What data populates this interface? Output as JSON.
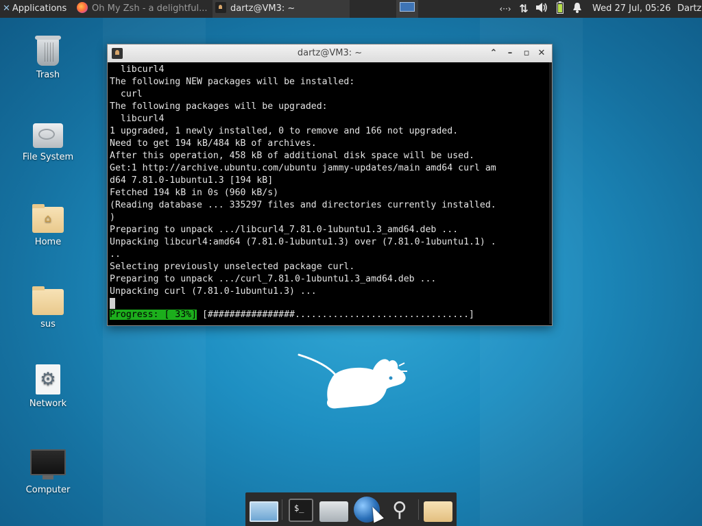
{
  "top_panel": {
    "apps_menu_label": "Applications",
    "tasks": [
      {
        "label": "Oh My Zsh - a delightful...",
        "icon": "firefox-icon",
        "active": false
      },
      {
        "label": "dartz@VM3: ~",
        "icon": "terminal-icon",
        "active": true
      }
    ],
    "tray": {
      "network": "‹··›",
      "updown": "⇅",
      "volume": "🔈",
      "battery": "▮",
      "notifications": "🔔"
    },
    "clock": "Wed 27 Jul, 05:26",
    "user": "Dartz"
  },
  "desktop_icons": [
    {
      "label": "Trash",
      "icon": "trash-icon"
    },
    {
      "label": "File System",
      "icon": "drive-icon"
    },
    {
      "label": "Home",
      "icon": "home-folder-icon"
    },
    {
      "label": "sus",
      "icon": "folder-icon"
    },
    {
      "label": "Network",
      "icon": "network-icon"
    },
    {
      "label": "Computer",
      "icon": "monitor-icon"
    }
  ],
  "terminal": {
    "title": "dartz@VM3: ~",
    "lines": [
      "  libcurl4",
      "The following NEW packages will be installed:",
      "  curl",
      "The following packages will be upgraded:",
      "  libcurl4",
      "1 upgraded, 1 newly installed, 0 to remove and 166 not upgraded.",
      "Need to get 194 kB/484 kB of archives.",
      "After this operation, 458 kB of additional disk space will be used.",
      "Get:1 http://archive.ubuntu.com/ubuntu jammy-updates/main amd64 curl am",
      "d64 7.81.0-1ubuntu1.3 [194 kB]",
      "Fetched 194 kB in 0s (960 kB/s)",
      "(Reading database ... 335297 files and directories currently installed.",
      ")",
      "Preparing to unpack .../libcurl4_7.81.0-1ubuntu1.3_amd64.deb ...",
      "Unpacking libcurl4:amd64 (7.81.0-1ubuntu1.3) over (7.81.0-1ubuntu1.1) .",
      "..",
      "Selecting previously unselected package curl.",
      "Preparing to unpack .../curl_7.81.0-1ubuntu1.3_amd64.deb ...",
      "Unpacking curl (7.81.0-1ubuntu1.3) ..."
    ],
    "progress_label": "Progress: [ 33%]",
    "progress_bar": " [################................................]",
    "progress_percent": 33
  },
  "dock": {
    "items": [
      "show-desktop",
      "terminal",
      "file-manager",
      "web-browser",
      "app-finder",
      "folder"
    ],
    "terminal_glyph": "$_"
  },
  "colors": {
    "desktop_bg": "#1e8fc2",
    "panel_bg": "#2b2b2b",
    "progress_green": "#1cae1c"
  }
}
